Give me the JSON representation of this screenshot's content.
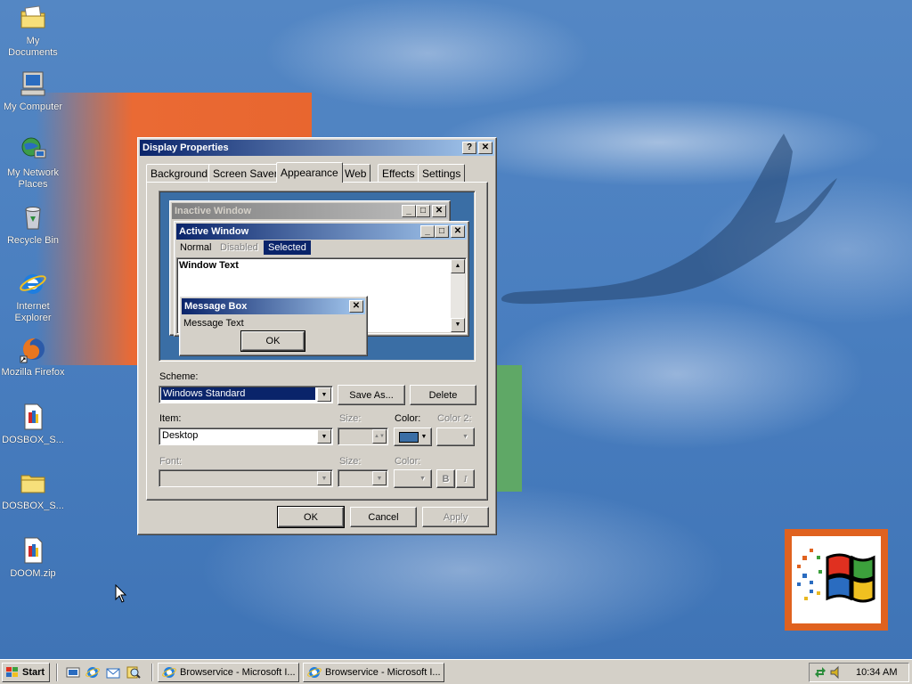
{
  "desktop": {
    "icons": [
      {
        "label": "My Documents",
        "icon": "folder-documents-icon"
      },
      {
        "label": "My Computer",
        "icon": "computer-icon"
      },
      {
        "label": "My Network Places",
        "icon": "network-icon"
      },
      {
        "label": "Recycle Bin",
        "icon": "recycle-bin-icon"
      },
      {
        "label": "Internet Explorer",
        "icon": "internet-explorer-icon"
      },
      {
        "label": "Mozilla Firefox",
        "icon": "firefox-icon"
      },
      {
        "label": "DOSBOX_S...",
        "icon": "installer-icon"
      },
      {
        "label": "DOSBOX_S...",
        "icon": "folder-icon"
      },
      {
        "label": "DOOM.zip",
        "icon": "zip-icon"
      }
    ]
  },
  "dialog": {
    "title": "Display Properties",
    "help_btn": "?",
    "close_btn": "✕",
    "tabs": [
      "Background",
      "Screen Saver",
      "Appearance",
      "Web",
      "Effects",
      "Settings"
    ],
    "selected_tab": "Appearance",
    "preview": {
      "inactive_title": "Inactive Window",
      "active_title": "Active Window",
      "menu": [
        "Normal",
        "Disabled",
        "Selected"
      ],
      "window_text": "Window Text",
      "message_box_title": "Message Box",
      "message_text": "Message Text",
      "ok": "OK"
    },
    "scheme_label": "Scheme:",
    "scheme_value": "Windows Standard",
    "save_as": "Save As...",
    "delete": "Delete",
    "item_label": "Item:",
    "item_value": "Desktop",
    "size_label": "Size:",
    "color_label": "Color:",
    "color2_label": "Color 2:",
    "font_label": "Font:",
    "font_size_label": "Size:",
    "font_color_label": "Color:",
    "bold": "B",
    "italic": "I",
    "ok": "OK",
    "cancel": "Cancel",
    "apply": "Apply",
    "item_color": "#3a6ea5"
  },
  "taskbar": {
    "start": "Start",
    "tasks": [
      "Browservice - Microsoft I...",
      "Browservice - Microsoft I..."
    ],
    "clock": "10:34 AM"
  }
}
